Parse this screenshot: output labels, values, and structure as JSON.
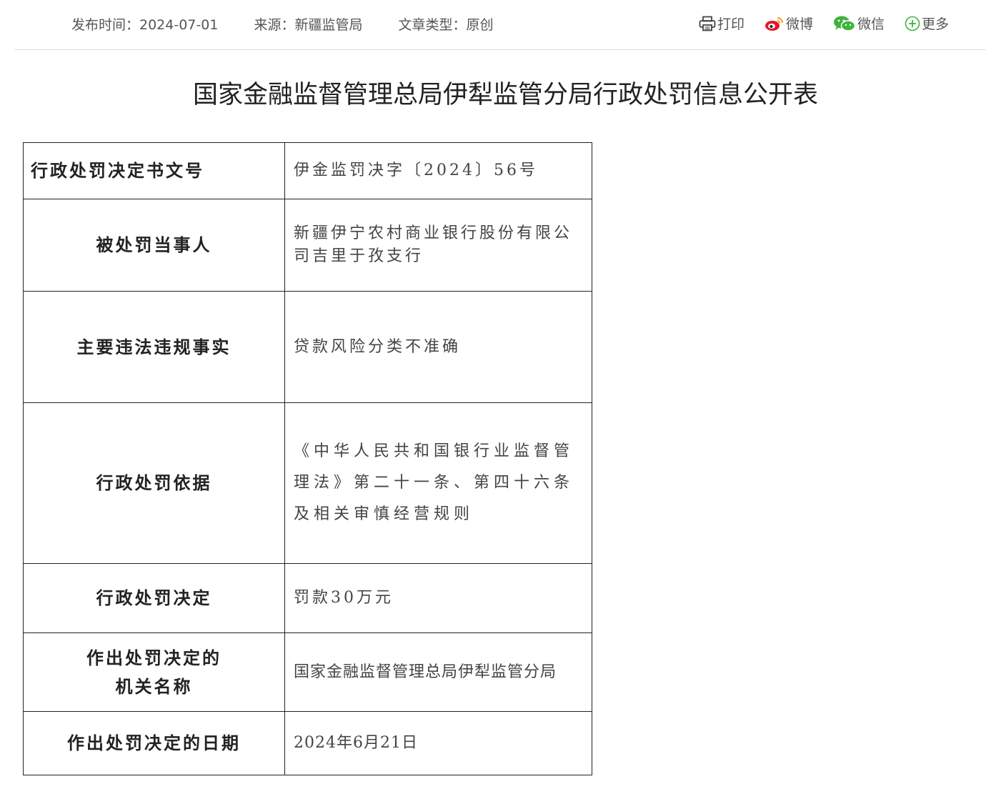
{
  "meta": {
    "publish": "发布时间：2024-07-01",
    "source": "来源：新疆监管局",
    "type": "文章类型：原创"
  },
  "share": {
    "print": "打印",
    "weibo": "微博",
    "wechat": "微信",
    "more": "更多"
  },
  "icons": {
    "print": "printer-icon",
    "weibo": "weibo-icon",
    "wechat": "wechat-icon",
    "more": "plus-circle-icon"
  },
  "colors": {
    "weibo": "#e6162d",
    "wechat": "#3fb33c",
    "more": "#3fb33c"
  },
  "title": "国家金融监督管理总局伊犁监管分局行政处罚信息公开表",
  "rows": [
    {
      "label": "行政处罚决定书文号",
      "value": "伊金监罚决字〔2024〕56号"
    },
    {
      "label": "被处罚当事人",
      "value": "新疆伊宁农村商业银行股份有限公司吉里于孜支行"
    },
    {
      "label": "主要违法违规事实",
      "value": "贷款风险分类不准确"
    },
    {
      "label": "行政处罚依据",
      "value": "《中华人民共和国银行业监督管理法》第二十一条、第四十六条及相关审慎经营规则"
    },
    {
      "label": "行政处罚决定",
      "value": "罚款30万元"
    },
    {
      "label": "作出处罚决定的机关名称",
      "value": "国家金融监督管理总局伊犁监管分局"
    },
    {
      "label": "作出处罚决定的日期",
      "value": "2024年6月21日"
    }
  ]
}
